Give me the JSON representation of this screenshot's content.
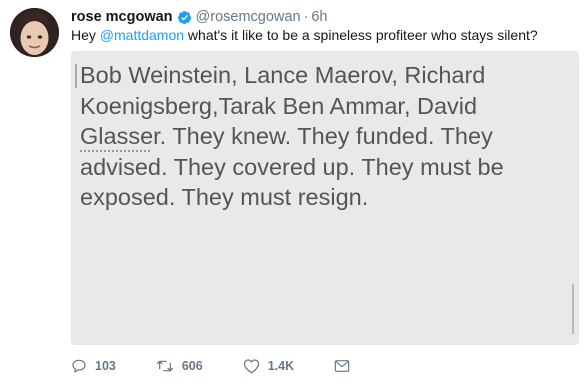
{
  "tweet": {
    "display_name": "rose mcgowan",
    "handle": "@rosemcgowan",
    "separator": "·",
    "time": "6h",
    "text_before": "Hey ",
    "mention": "@mattdamon",
    "text_after": " what's it like to be a spineless profiteer who stays silent?",
    "image_text": "Bob Weinstein, Lance Maerov, Richard\nKoenigsberg,Tarak Ben Ammar, David\nGlasser. They knew. They funded. They\nadvised. They covered up. They must be\nexposed. They must resign.",
    "actions": {
      "replies": "103",
      "retweets": "606",
      "likes": "1.4K"
    },
    "colors": {
      "verified": "#1da1f2",
      "mention": "#1da1f2",
      "meta": "#657786"
    },
    "icons": [
      "verified-badge-icon",
      "reply-icon",
      "retweet-icon",
      "like-icon",
      "direct-message-icon"
    ]
  }
}
